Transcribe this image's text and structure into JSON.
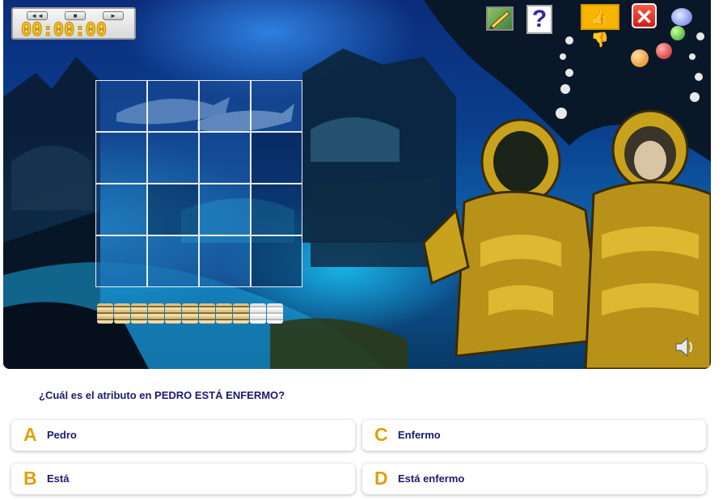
{
  "timer": {
    "display": "00:00:00",
    "buttons": [
      "◄◄",
      "■",
      "►"
    ]
  },
  "toolbar": {
    "help_glyph": "?",
    "thumbs_glyph": "👍👎",
    "close_glyph": "✕"
  },
  "puzzle": {
    "rows": 4,
    "cols": 4,
    "tile_state": [
      "filled",
      "filled",
      "filled",
      "filled",
      "filled",
      "filled",
      "filled",
      "dark",
      "filled",
      "dark",
      "filled",
      "dark",
      "filled",
      "filled",
      "filled",
      "dark"
    ],
    "tray_pieces": 11,
    "tray_empty": 2
  },
  "question": {
    "text": "¿Cuál es el atributo en PEDRO ESTÁ ENFERMO?"
  },
  "answers": [
    {
      "letter": "A",
      "text": "Pedro"
    },
    {
      "letter": "B",
      "text": "Está"
    },
    {
      "letter": "C",
      "text": "Enfermo"
    },
    {
      "letter": "D",
      "text": "Está enfermo"
    }
  ],
  "colors": {
    "letter": "#e0a10b",
    "text": "#1c1a6e"
  }
}
